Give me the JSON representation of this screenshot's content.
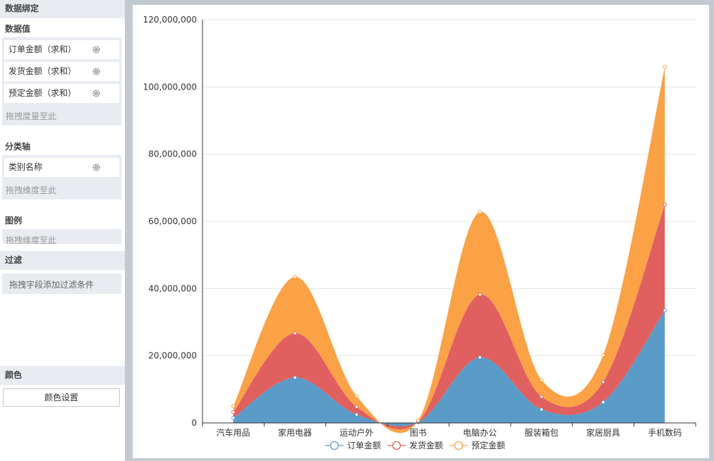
{
  "sidebar": {
    "binding_title": "数据绑定",
    "values_title": "数据值",
    "value_fields": [
      "订单金额（求和）",
      "发货金额（求和）",
      "预定金额（求和）"
    ],
    "values_hint": "拖拽度量至此",
    "axis_title": "分类轴",
    "axis_fields": [
      "类别名称"
    ],
    "axis_hint": "拖拽维度至此",
    "legend_title": "图例",
    "legend_hint": "拖拽维度至此",
    "filter_title": "过滤",
    "filter_hint": "拖拽字段添加过滤条件",
    "color_title": "颜色",
    "color_button": "颜色设置"
  },
  "chart_data": {
    "type": "area",
    "stacked": true,
    "categories": [
      "汽车用品",
      "家用电器",
      "运动户外",
      "图书",
      "电脑办公",
      "服装箱包",
      "家居厨具",
      "手机数码"
    ],
    "ylim": [
      0,
      120000000
    ],
    "yticks": [
      "0",
      "20,000,000",
      "40,000,000",
      "60,000,000",
      "80,000,000",
      "100,000,000",
      "120,000,000"
    ],
    "grid": true,
    "legend_position": "bottom",
    "series": [
      {
        "name": "订单金额",
        "color": "#5b9bc8",
        "values": [
          1500000,
          13500000,
          2500000,
          200000,
          19500000,
          4000000,
          6200000,
          33500000
        ]
      },
      {
        "name": "发货金额",
        "color": "#e06060",
        "values": [
          1700000,
          13200000,
          2300000,
          200000,
          18700000,
          3800000,
          6000000,
          31500000
        ]
      },
      {
        "name": "预定金额",
        "color": "#fba146",
        "values": [
          1800000,
          16800000,
          3200000,
          400000,
          24600000,
          5000000,
          8000000,
          41000000
        ]
      }
    ]
  }
}
